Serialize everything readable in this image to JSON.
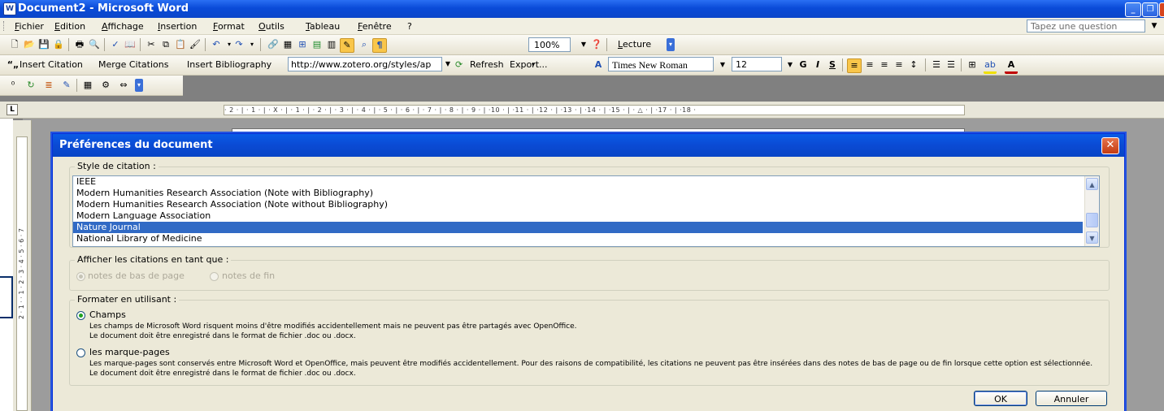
{
  "window": {
    "title": "Document2 - Microsoft Word"
  },
  "menubar": {
    "items": [
      "Fichier",
      "Edition",
      "Affichage",
      "Insertion",
      "Format",
      "Outils",
      "Tableau",
      "Fenêtre",
      "?"
    ],
    "ask_placeholder": "Tapez une question"
  },
  "toolbar_standard": {
    "zoom": "100%",
    "reading_label": "Lecture"
  },
  "toolbar_zotero": {
    "insert_citation": "Insert Citation",
    "merge_citations": "Merge Citations",
    "insert_bibliography": "Insert Bibliography",
    "style_url": "http://www.zotero.org/styles/ap",
    "refresh": "Refresh",
    "export": "Export..."
  },
  "toolbar_format": {
    "font_name": "Times New Roman",
    "font_size": "12",
    "bold": "G",
    "italic": "I",
    "strike": "S"
  },
  "ruler": {
    "marks": "· 2 · | · 1 · | · X · | · 1 · | · 2 · | · 3 · | · 4 · | · 5 · | · 6 · | · 7 · | · 8 · | · 9 · | ·10 · | ·11 · | ·12 · | ·13 · | ·14 · | ·15 · | · △ · | ·17 · | ·18 ·"
  },
  "vertical_ruler": {
    "marks": "2 · 1 · · 1 · 2 · 3 · 4 · 5 · 6 · 7"
  },
  "dialog": {
    "title": "Préférences du document",
    "close_glyph": "✕",
    "style_group_label": "Style de citation :",
    "styles": [
      "IEEE",
      "Modern Humanities Research Association (Note with Bibliography)",
      "Modern Humanities Research Association (Note without Bibliography)",
      "Modern Language Association",
      "Nature Journal",
      "National Library of Medicine"
    ],
    "selected_style": "Nature Journal",
    "display_group_label": "Afficher les citations en tant que :",
    "display_footnotes": "notes de bas de page",
    "display_endnotes": "notes de fin",
    "format_group_label": "Formater en utilisant :",
    "fields_label": "Champs",
    "fields_desc_1": "Les champs de Microsoft Word risquent moins d'être modifiés accidentellement mais ne peuvent pas être partagés avec OpenOffice.",
    "fields_desc_2": "Le document doit être enregistré dans le format de fichier .doc ou .docx.",
    "bookmarks_label": "les marque-pages",
    "bookmarks_desc_1": "Les marque-pages sont conservés entre Microsoft Word et OpenOffice, mais peuvent être modifiés accidentellement. Pour des raisons de compatibilité, les citations ne peuvent pas être insérées dans des notes de bas de page ou de fin lorsque cette option est sélectionnée.",
    "bookmarks_desc_2": "Le document doit être enregistré dans le format de fichier .doc ou .docx.",
    "ok": "OK",
    "cancel": "Annuler"
  },
  "colors": {
    "xp_blue": "#0a4ad4",
    "selection": "#316ac5",
    "dialog_bg": "#ece9d8",
    "close_red": "#c43a11"
  }
}
